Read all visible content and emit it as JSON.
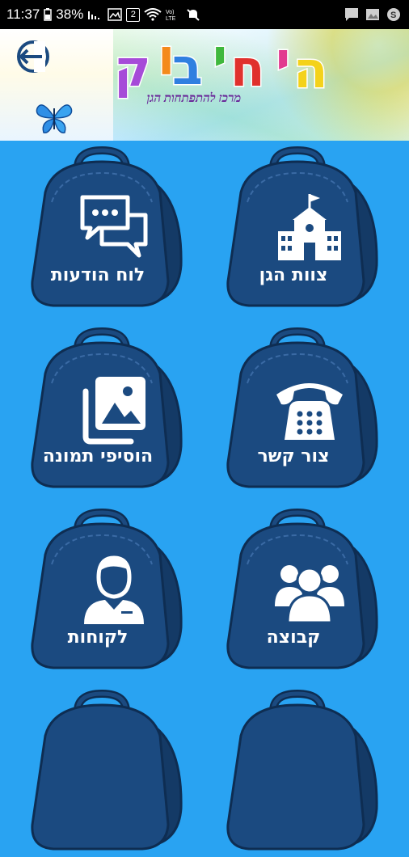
{
  "status_bar": {
    "time": "11:37",
    "battery_percent": "38%",
    "notification_count": "2",
    "icons": [
      "sim-icon",
      "battery-icon",
      "signal-icon",
      "image-icon",
      "notification-icon",
      "wifi-icon",
      "volte-icon",
      "mute-icon",
      "chat-icon",
      "gallery-icon",
      "skype-icon"
    ]
  },
  "header": {
    "logo_text": "הי חיבוק",
    "subtitle": "מרכז להתפתחות הגן",
    "back_icon": "logout-icon",
    "decor_icon": "butterfly-icon"
  },
  "colors": {
    "background": "#29a3f2",
    "tile": "#1b4a80",
    "tile_dark": "#143a66",
    "tile_outline": "#0e2d52"
  },
  "tiles": [
    {
      "label": "צוות הגן",
      "icon": "school-icon"
    },
    {
      "label": "לוח הודעות",
      "icon": "chat-bubbles-icon"
    },
    {
      "label": "צור קשר",
      "icon": "telephone-icon"
    },
    {
      "label": "הוסיפי תמונה",
      "icon": "photos-icon"
    },
    {
      "label": "קבוצה",
      "icon": "group-icon"
    },
    {
      "label": "לקוחות",
      "icon": "person-icon"
    }
  ]
}
